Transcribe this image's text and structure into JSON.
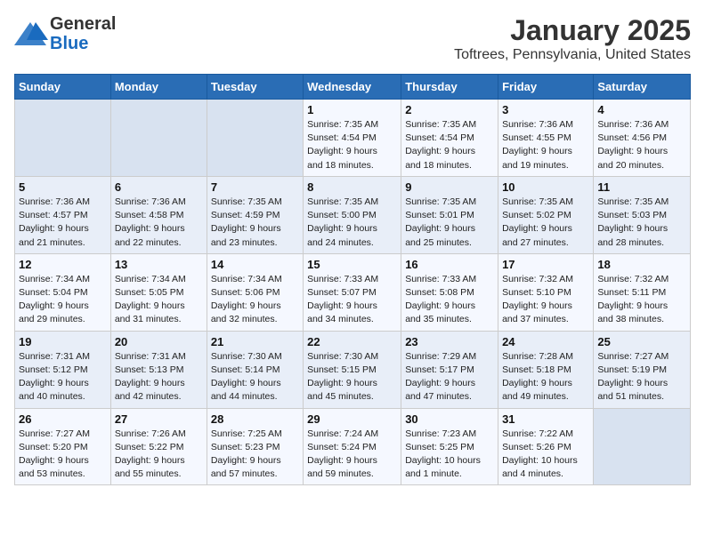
{
  "header": {
    "logo_general": "General",
    "logo_blue": "Blue",
    "month": "January 2025",
    "location": "Toftrees, Pennsylvania, United States"
  },
  "days_of_week": [
    "Sunday",
    "Monday",
    "Tuesday",
    "Wednesday",
    "Thursday",
    "Friday",
    "Saturday"
  ],
  "weeks": [
    [
      {
        "day": "",
        "info": ""
      },
      {
        "day": "",
        "info": ""
      },
      {
        "day": "",
        "info": ""
      },
      {
        "day": "1",
        "info": "Sunrise: 7:35 AM\nSunset: 4:54 PM\nDaylight: 9 hours\nand 18 minutes."
      },
      {
        "day": "2",
        "info": "Sunrise: 7:35 AM\nSunset: 4:54 PM\nDaylight: 9 hours\nand 18 minutes."
      },
      {
        "day": "3",
        "info": "Sunrise: 7:36 AM\nSunset: 4:55 PM\nDaylight: 9 hours\nand 19 minutes."
      },
      {
        "day": "4",
        "info": "Sunrise: 7:36 AM\nSunset: 4:56 PM\nDaylight: 9 hours\nand 20 minutes."
      }
    ],
    [
      {
        "day": "5",
        "info": "Sunrise: 7:36 AM\nSunset: 4:57 PM\nDaylight: 9 hours\nand 21 minutes."
      },
      {
        "day": "6",
        "info": "Sunrise: 7:36 AM\nSunset: 4:58 PM\nDaylight: 9 hours\nand 22 minutes."
      },
      {
        "day": "7",
        "info": "Sunrise: 7:35 AM\nSunset: 4:59 PM\nDaylight: 9 hours\nand 23 minutes."
      },
      {
        "day": "8",
        "info": "Sunrise: 7:35 AM\nSunset: 5:00 PM\nDaylight: 9 hours\nand 24 minutes."
      },
      {
        "day": "9",
        "info": "Sunrise: 7:35 AM\nSunset: 5:01 PM\nDaylight: 9 hours\nand 25 minutes."
      },
      {
        "day": "10",
        "info": "Sunrise: 7:35 AM\nSunset: 5:02 PM\nDaylight: 9 hours\nand 27 minutes."
      },
      {
        "day": "11",
        "info": "Sunrise: 7:35 AM\nSunset: 5:03 PM\nDaylight: 9 hours\nand 28 minutes."
      }
    ],
    [
      {
        "day": "12",
        "info": "Sunrise: 7:34 AM\nSunset: 5:04 PM\nDaylight: 9 hours\nand 29 minutes."
      },
      {
        "day": "13",
        "info": "Sunrise: 7:34 AM\nSunset: 5:05 PM\nDaylight: 9 hours\nand 31 minutes."
      },
      {
        "day": "14",
        "info": "Sunrise: 7:34 AM\nSunset: 5:06 PM\nDaylight: 9 hours\nand 32 minutes."
      },
      {
        "day": "15",
        "info": "Sunrise: 7:33 AM\nSunset: 5:07 PM\nDaylight: 9 hours\nand 34 minutes."
      },
      {
        "day": "16",
        "info": "Sunrise: 7:33 AM\nSunset: 5:08 PM\nDaylight: 9 hours\nand 35 minutes."
      },
      {
        "day": "17",
        "info": "Sunrise: 7:32 AM\nSunset: 5:10 PM\nDaylight: 9 hours\nand 37 minutes."
      },
      {
        "day": "18",
        "info": "Sunrise: 7:32 AM\nSunset: 5:11 PM\nDaylight: 9 hours\nand 38 minutes."
      }
    ],
    [
      {
        "day": "19",
        "info": "Sunrise: 7:31 AM\nSunset: 5:12 PM\nDaylight: 9 hours\nand 40 minutes."
      },
      {
        "day": "20",
        "info": "Sunrise: 7:31 AM\nSunset: 5:13 PM\nDaylight: 9 hours\nand 42 minutes."
      },
      {
        "day": "21",
        "info": "Sunrise: 7:30 AM\nSunset: 5:14 PM\nDaylight: 9 hours\nand 44 minutes."
      },
      {
        "day": "22",
        "info": "Sunrise: 7:30 AM\nSunset: 5:15 PM\nDaylight: 9 hours\nand 45 minutes."
      },
      {
        "day": "23",
        "info": "Sunrise: 7:29 AM\nSunset: 5:17 PM\nDaylight: 9 hours\nand 47 minutes."
      },
      {
        "day": "24",
        "info": "Sunrise: 7:28 AM\nSunset: 5:18 PM\nDaylight: 9 hours\nand 49 minutes."
      },
      {
        "day": "25",
        "info": "Sunrise: 7:27 AM\nSunset: 5:19 PM\nDaylight: 9 hours\nand 51 minutes."
      }
    ],
    [
      {
        "day": "26",
        "info": "Sunrise: 7:27 AM\nSunset: 5:20 PM\nDaylight: 9 hours\nand 53 minutes."
      },
      {
        "day": "27",
        "info": "Sunrise: 7:26 AM\nSunset: 5:22 PM\nDaylight: 9 hours\nand 55 minutes."
      },
      {
        "day": "28",
        "info": "Sunrise: 7:25 AM\nSunset: 5:23 PM\nDaylight: 9 hours\nand 57 minutes."
      },
      {
        "day": "29",
        "info": "Sunrise: 7:24 AM\nSunset: 5:24 PM\nDaylight: 9 hours\nand 59 minutes."
      },
      {
        "day": "30",
        "info": "Sunrise: 7:23 AM\nSunset: 5:25 PM\nDaylight: 10 hours\nand 1 minute."
      },
      {
        "day": "31",
        "info": "Sunrise: 7:22 AM\nSunset: 5:26 PM\nDaylight: 10 hours\nand 4 minutes."
      },
      {
        "day": "",
        "info": ""
      }
    ]
  ]
}
